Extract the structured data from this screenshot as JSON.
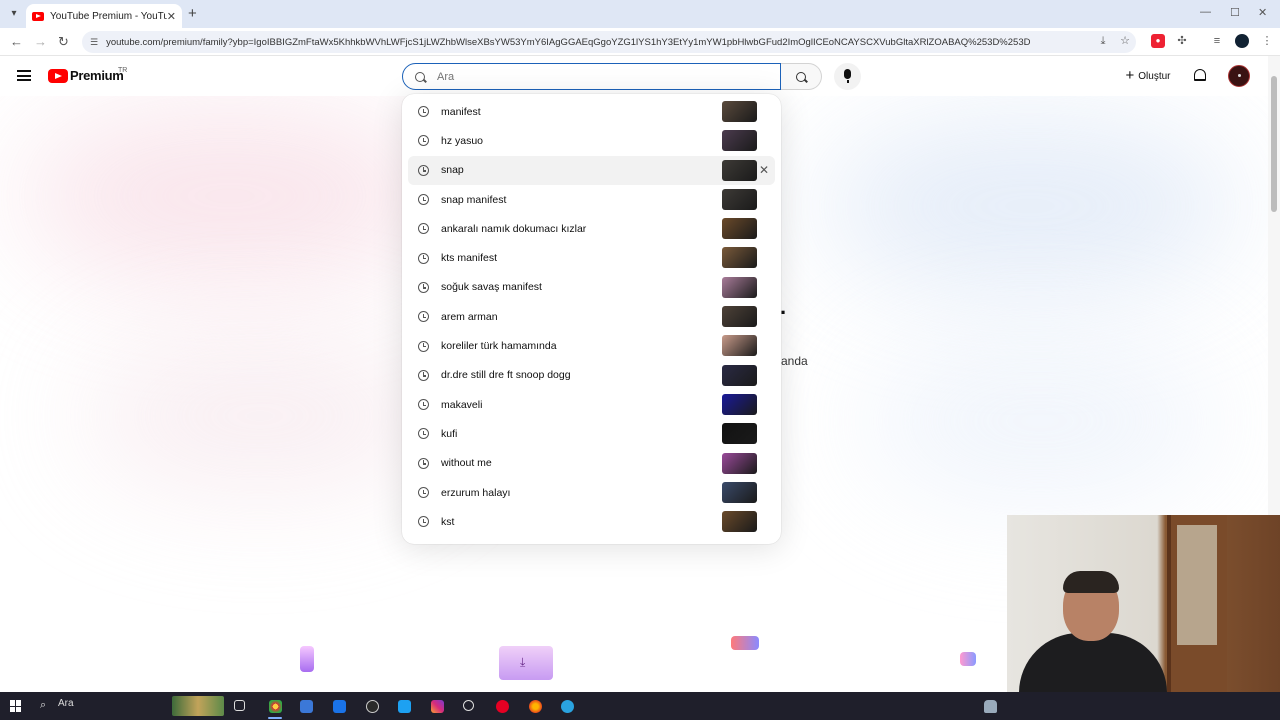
{
  "browser": {
    "tab_title": "YouTube Premium - YouTube",
    "url": "youtube.com/premium/family?ybp=IgoIBBIGZmFtaWx5KhhkbWVhLWFjcS1jLWZhbWlseXBsYW53YmY6IAgGGAEqGgoYZG1lYS1hY3EtYy1mYW1pbHlwbGFud2ImOglICEoNCAYSCXVubGltaXRlZOABAQ%253D%253D"
  },
  "masthead": {
    "brand": "Premium",
    "region": "TR",
    "search_placeholder": "Ara",
    "create_label": "Oluştur"
  },
  "page": {
    "fragment_heading": ".",
    "fragment_text": "anda"
  },
  "suggestions": [
    {
      "text": "manifest",
      "thumb": "#5a4a3c"
    },
    {
      "text": "hz yasuo",
      "thumb": "#4b3b4e"
    },
    {
      "text": "snap",
      "thumb": "#3d3a36"
    },
    {
      "text": "snap manifest",
      "thumb": "#3d3a36"
    },
    {
      "text": "ankaralı namık dokumacı kızlar",
      "thumb": "#6b4a2a"
    },
    {
      "text": "kts manifest",
      "thumb": "#7a5a3a"
    },
    {
      "text": "soğuk savaş manifest",
      "thumb": "#a97c9a"
    },
    {
      "text": "arem arman",
      "thumb": "#4e4238"
    },
    {
      "text": "koreliler türk hamamında",
      "thumb": "#c89b8a"
    },
    {
      "text": "dr.dre still dre ft snoop dogg",
      "thumb": "#2a2a44"
    },
    {
      "text": "makaveli",
      "thumb": "#1a1a9a"
    },
    {
      "text": "kufi",
      "thumb": "#121212"
    },
    {
      "text": "without me",
      "thumb": "#9a4a9a"
    },
    {
      "text": "erzurum halayı",
      "thumb": "#3a4a6a"
    },
    {
      "text": "kst",
      "thumb": "#6a4a2a"
    }
  ],
  "taskbar": {
    "search_label": "Ara"
  },
  "colors": {
    "accent": "#ff0000",
    "search_border": "#1c62b9"
  }
}
